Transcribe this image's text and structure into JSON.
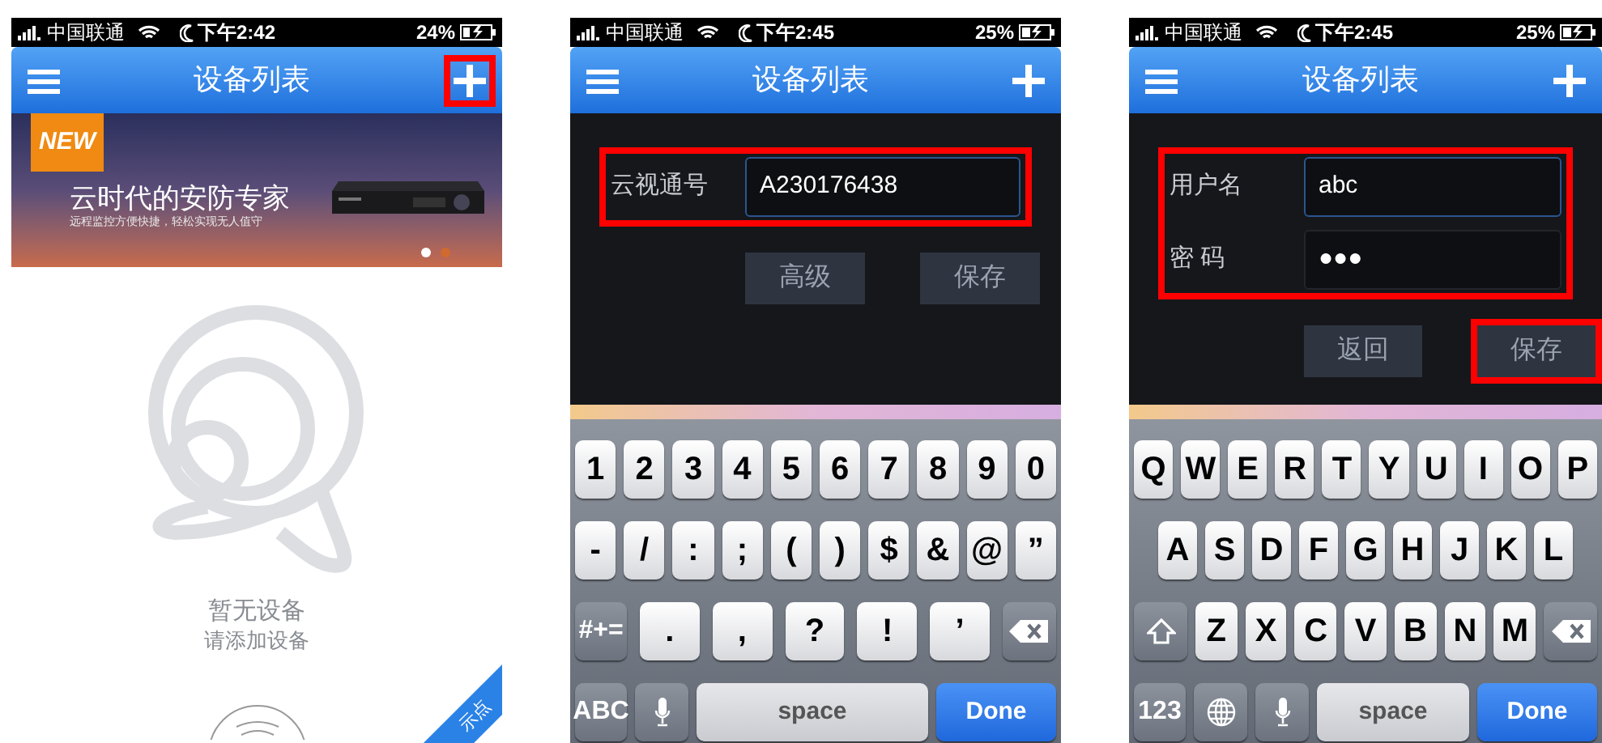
{
  "screens": [
    {
      "kind": "device_list",
      "status_bar": {
        "carrier": "中国联通",
        "time": "下午2:42",
        "battery": "24%"
      },
      "nav": {
        "title": "设备列表",
        "add_highlighted": true
      },
      "banner": {
        "badge": "NEW",
        "headline": "云时代的安防专家",
        "subline": "远程监控方便快捷，轻松实现无人值守",
        "page_dots": [
          {
            "selected": true
          },
          {
            "selected": false
          }
        ]
      },
      "empty": {
        "title": "暂无设备",
        "hint": "请添加设备"
      },
      "ribbon": "示点"
    },
    {
      "kind": "form",
      "status_bar": {
        "carrier": "中国联通",
        "time": "下午2:45",
        "battery": "25%"
      },
      "nav": {
        "title": "设备列表",
        "add_highlighted": false
      },
      "form": {
        "highlighted": true,
        "fields": [
          {
            "label": "云视通号",
            "value": "A230176438",
            "focused": true
          }
        ]
      },
      "buttons": [
        {
          "label": "高级",
          "highlighted": false
        },
        {
          "label": "保存",
          "highlighted": false
        }
      ],
      "keyboard": [
        [
          {
            "kind": "char",
            "label": "1"
          },
          {
            "kind": "char",
            "label": "2"
          },
          {
            "kind": "char",
            "label": "3"
          },
          {
            "kind": "char",
            "label": "4"
          },
          {
            "kind": "char",
            "label": "5"
          },
          {
            "kind": "char",
            "label": "6"
          },
          {
            "kind": "char",
            "label": "7"
          },
          {
            "kind": "char",
            "label": "8"
          },
          {
            "kind": "char",
            "label": "9"
          },
          {
            "kind": "char",
            "label": "0"
          }
        ],
        [
          {
            "kind": "char",
            "label": "-"
          },
          {
            "kind": "char",
            "label": "/"
          },
          {
            "kind": "char",
            "label": ":"
          },
          {
            "kind": "char",
            "label": ";"
          },
          {
            "kind": "char",
            "label": "("
          },
          {
            "kind": "char",
            "label": ")"
          },
          {
            "kind": "char",
            "label": "$"
          },
          {
            "kind": "char",
            "label": "&"
          },
          {
            "kind": "char",
            "label": "@"
          },
          {
            "kind": "char",
            "label": "”"
          }
        ],
        [
          {
            "kind": "function",
            "label": "#+="
          },
          {
            "kind": "char",
            "label": "."
          },
          {
            "kind": "char",
            "label": ","
          },
          {
            "kind": "char",
            "label": "?"
          },
          {
            "kind": "char",
            "label": "!"
          },
          {
            "kind": "char",
            "label": "’"
          },
          {
            "kind": "delete"
          }
        ],
        [
          {
            "kind": "function",
            "label": "ABC"
          },
          {
            "kind": "mic"
          },
          {
            "kind": "space",
            "label": "space"
          },
          {
            "kind": "done",
            "label": "Done"
          }
        ]
      ]
    },
    {
      "kind": "form",
      "status_bar": {
        "carrier": "中国联通",
        "time": "下午2:45",
        "battery": "25%"
      },
      "nav": {
        "title": "设备列表",
        "add_highlighted": false
      },
      "form": {
        "highlighted": true,
        "fields": [
          {
            "label": "用户名",
            "value": "abc",
            "focused": true
          },
          {
            "label": "密 码",
            "value": "●●●",
            "focused": false
          }
        ]
      },
      "buttons": [
        {
          "label": "返回",
          "highlighted": false
        },
        {
          "label": "保存",
          "highlighted": true
        }
      ],
      "keyboard": [
        [
          {
            "kind": "char",
            "label": "Q"
          },
          {
            "kind": "char",
            "label": "W"
          },
          {
            "kind": "char",
            "label": "E"
          },
          {
            "kind": "char",
            "label": "R"
          },
          {
            "kind": "char",
            "label": "T"
          },
          {
            "kind": "char",
            "label": "Y"
          },
          {
            "kind": "char",
            "label": "U"
          },
          {
            "kind": "char",
            "label": "I"
          },
          {
            "kind": "char",
            "label": "O"
          },
          {
            "kind": "char",
            "label": "P"
          }
        ],
        [
          {
            "kind": "char",
            "label": "A"
          },
          {
            "kind": "char",
            "label": "S"
          },
          {
            "kind": "char",
            "label": "D"
          },
          {
            "kind": "char",
            "label": "F"
          },
          {
            "kind": "char",
            "label": "G"
          },
          {
            "kind": "char",
            "label": "H"
          },
          {
            "kind": "char",
            "label": "J"
          },
          {
            "kind": "char",
            "label": "K"
          },
          {
            "kind": "char",
            "label": "L"
          }
        ],
        [
          {
            "kind": "shift"
          },
          {
            "kind": "char",
            "label": "Z"
          },
          {
            "kind": "char",
            "label": "X"
          },
          {
            "kind": "char",
            "label": "C"
          },
          {
            "kind": "char",
            "label": "V"
          },
          {
            "kind": "char",
            "label": "B"
          },
          {
            "kind": "char",
            "label": "N"
          },
          {
            "kind": "char",
            "label": "M"
          },
          {
            "kind": "delete"
          }
        ],
        [
          {
            "kind": "function",
            "label": "123"
          },
          {
            "kind": "globe"
          },
          {
            "kind": "mic"
          },
          {
            "kind": "space",
            "label": "space"
          },
          {
            "kind": "done",
            "label": "Done"
          }
        ]
      ]
    }
  ]
}
